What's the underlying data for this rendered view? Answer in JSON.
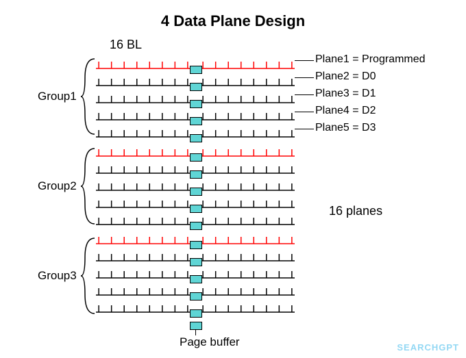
{
  "title": "4 Data Plane Design",
  "bl_label": "16 BL",
  "bl_count": 16,
  "groups": [
    {
      "name": "Group1",
      "rows_per_group": 5
    },
    {
      "name": "Group2",
      "rows_per_group": 5
    },
    {
      "name": "Group3",
      "rows_per_group": 5
    }
  ],
  "programmed_color": "#ff0000",
  "normal_color": "#000000",
  "plane_labels": [
    "Plane1 = Programmed",
    "Plane2 = D0",
    "Plane3 = D1",
    "Plane4 = D2",
    "Plane5 = D3"
  ],
  "planes_label": "16 planes",
  "page_buffer_label": "Page buffer",
  "watermark": "SEARCHGPT"
}
